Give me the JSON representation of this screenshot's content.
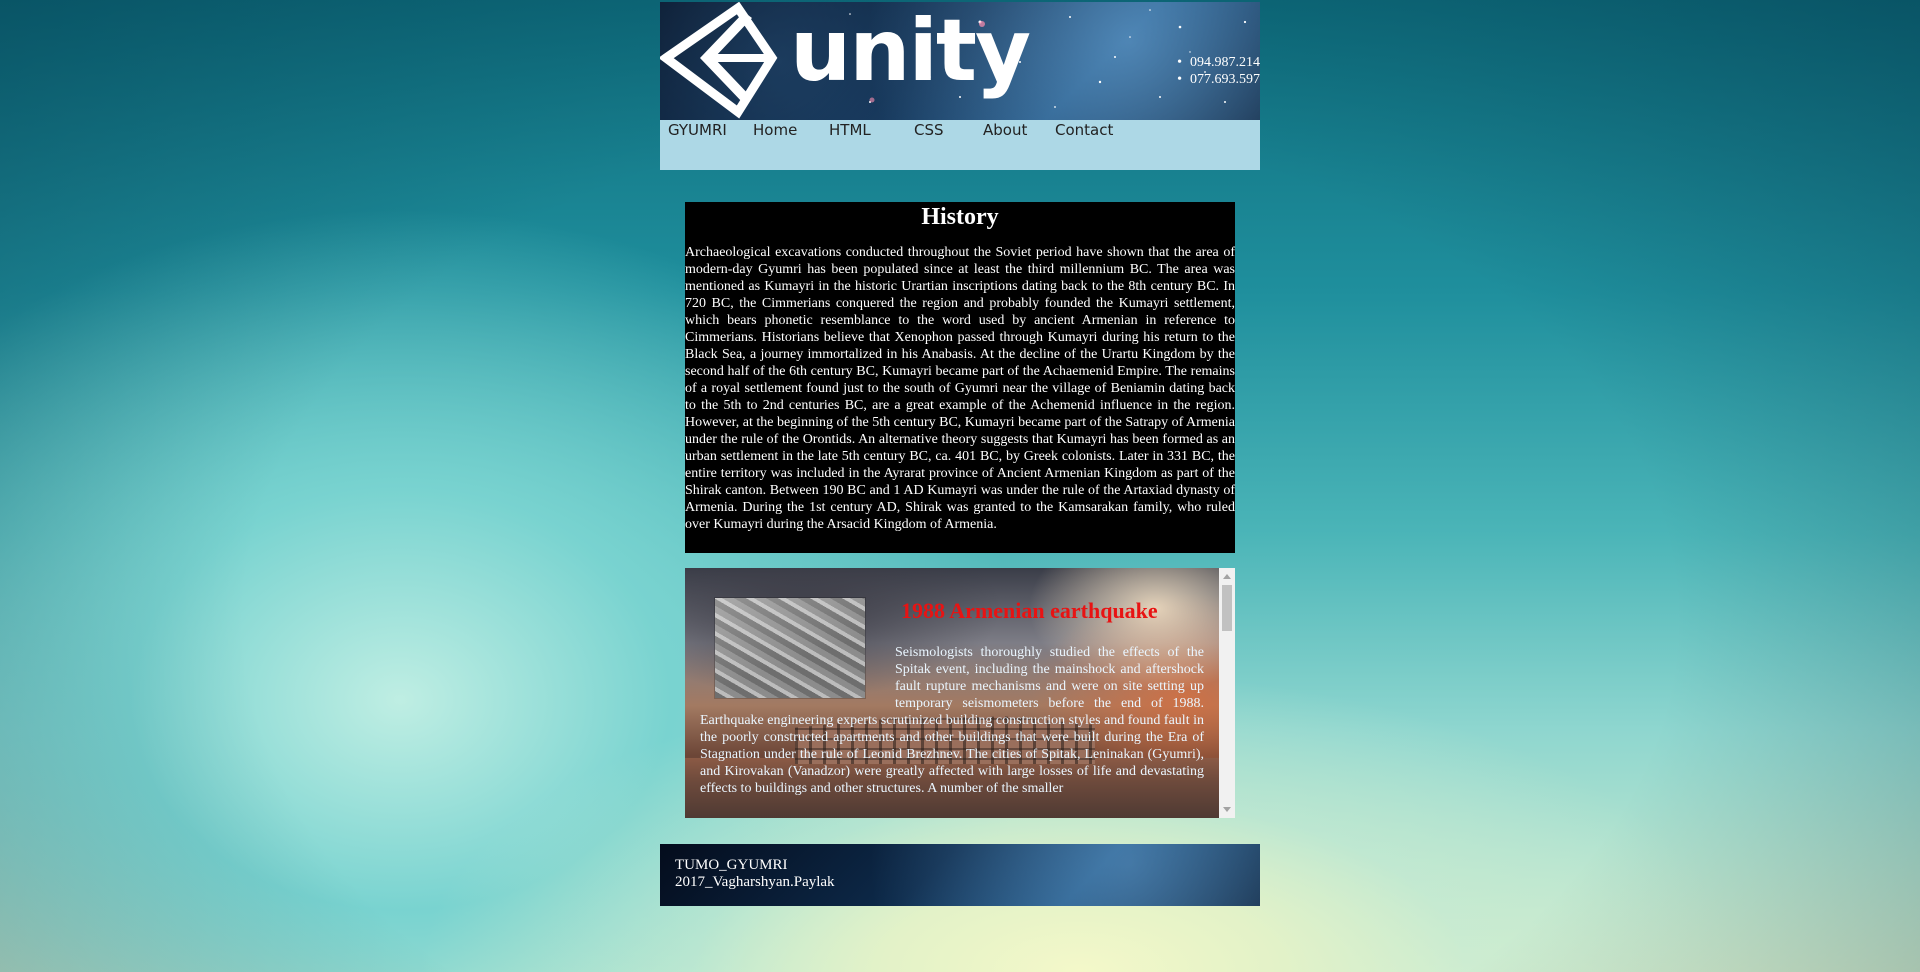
{
  "header": {
    "logo_text": "unity",
    "phones": [
      "094.987.214",
      "077.693.597"
    ]
  },
  "nav": {
    "items": [
      "GYUMRI",
      "Home",
      "HTML",
      "CSS",
      "About",
      "Contact"
    ]
  },
  "history": {
    "title": "History",
    "body": "Archaeological excavations conducted throughout the Soviet period have shown that the area of modern-day Gyumri has been populated since at least the third millennium BC. The area was mentioned as Kumayri in the historic Urartian inscriptions dating back to the 8th century BC. In 720 BC, the Cimmerians conquered the region and probably founded the Kumayri settlement, which bears phonetic resemblance to the word used by ancient Armenian in reference to Cimmerians. Historians believe that Xenophon passed through Kumayri during his return to the Black Sea, a journey immortalized in his Anabasis. At the decline of the Urartu Kingdom by the second half of the 6th century BC, Kumayri became part of the Achaemenid Empire. The remains of a royal settlement found just to the south of Gyumri near the village of Beniamin dating back to the 5th to 2nd centuries BC, are a great example of the Achemenid influence in the region. However, at the beginning of the 5th century BC, Kumayri became part of the Satrapy of Armenia under the rule of the Orontids. An alternative theory suggests that Kumayri has been formed as an urban settlement in the late 5th century BC, ca. 401 BC, by Greek colonists. Later in 331 BC, the entire territory was included in the Ayrarat province of Ancient Armenian Kingdom as part of the Shirak canton. Between 190 BC and 1 AD Kumayri was under the rule of the Artaxiad dynasty of Armenia. During the 1st century AD, Shirak was granted to the Kamsarakan family, who ruled over Kumayri during the Arsacid Kingdom of Armenia."
  },
  "earthquake": {
    "title": "1988 Armenian earthquake",
    "body": "Seismologists thoroughly studied the effects of the Spitak event, including the mainshock and aftershock fault rupture mechanisms and were on site setting up temporary seismometers before the end of 1988. Earthquake engineering experts scrutinized building construction styles and found fault in the poorly constructed apartments and other buildings that were built during the Era of Stagnation under the rule of Leonid Brezhnev. The cities of Spitak, Leninakan (Gyumri), and Kirovakan (Vanadzor) were greatly affected with large losses of life and devastating effects to buildings and other structures. A number of the smaller"
  },
  "footer": {
    "line1": "TUMO_GYUMRI",
    "line2": "2017_Vagharshyan.Paylak"
  }
}
